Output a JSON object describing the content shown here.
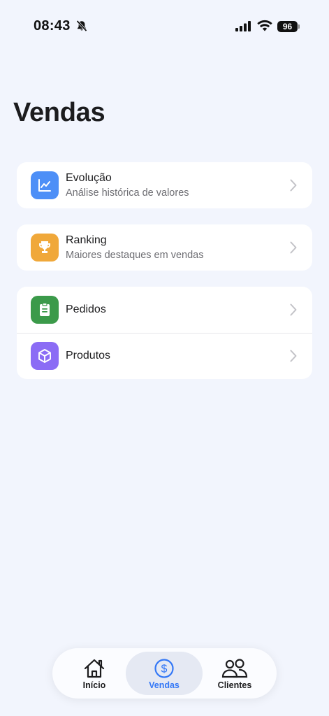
{
  "status_bar": {
    "time": "08:43",
    "battery": "96",
    "icons": [
      "bell-slash-icon",
      "signal-icon",
      "wifi-icon",
      "battery-icon"
    ]
  },
  "page": {
    "title": "Vendas"
  },
  "menu": {
    "evolucao": {
      "title": "Evolução",
      "subtitle": "Análise histórica de valores",
      "icon": "chart-line-icon",
      "color": "#4d8ff7"
    },
    "ranking": {
      "title": "Ranking",
      "subtitle": "Maiores destaques em vendas",
      "icon": "trophy-icon",
      "color": "#f0a83a"
    },
    "pedidos": {
      "title": "Pedidos",
      "icon": "clipboard-icon",
      "color": "#3b9a4a"
    },
    "produtos": {
      "title": "Produtos",
      "icon": "box-icon",
      "color": "#8b6cf5"
    }
  },
  "tab_bar": {
    "inicio": {
      "label": "Início",
      "icon": "house-icon"
    },
    "vendas": {
      "label": "Vendas",
      "icon": "dollar-circle-icon",
      "active": true
    },
    "clientes": {
      "label": "Clientes",
      "icon": "people-icon"
    }
  },
  "colors": {
    "background": "#f2f5fd",
    "accent": "#3478f6"
  }
}
